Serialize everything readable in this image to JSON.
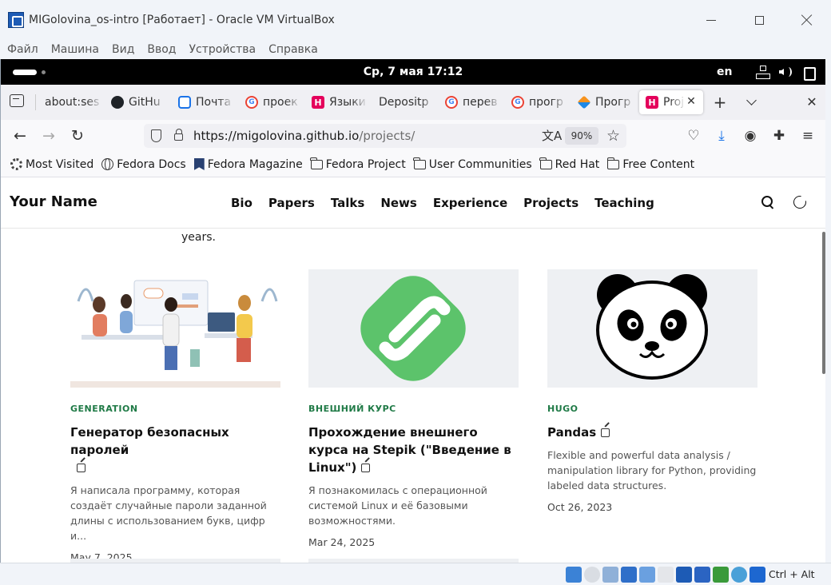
{
  "vbox": {
    "title": "MIGolovina_os-intro [Работает] - Oracle VM VirtualBox",
    "menu": [
      "Файл",
      "Машина",
      "Вид",
      "Ввод",
      "Устройства",
      "Справка"
    ],
    "host_key": "Ctrl + Alt"
  },
  "gnome": {
    "clock": "Ср, 7 мая  17:12",
    "lang": "en"
  },
  "firefox": {
    "tabs": [
      {
        "label": "about:ses",
        "favicon": "none"
      },
      {
        "label": "GitHu",
        "favicon": "github-icon"
      },
      {
        "label": "Почта",
        "favicon": "mail-icon"
      },
      {
        "label": "проек",
        "favicon": "google-icon"
      },
      {
        "label": "Языки",
        "favicon": "h-icon"
      },
      {
        "label": "Depositp",
        "favicon": "none"
      },
      {
        "label": "перев",
        "favicon": "google-icon"
      },
      {
        "label": "прогр",
        "favicon": "google-icon"
      },
      {
        "label": "Прогр",
        "favicon": "kotlin-icon"
      }
    ],
    "active_tab": {
      "label": "Proj",
      "favicon": "h-icon"
    },
    "url": {
      "host": "https://migolovina.github.io",
      "path": "/projects/",
      "zoom": "90%"
    },
    "bookmarks": [
      {
        "label": "Most Visited",
        "icon": "gear-icon"
      },
      {
        "label": "Fedora Docs",
        "icon": "globe-icon"
      },
      {
        "label": "Fedora Magazine",
        "icon": "fedora-magazine-icon"
      },
      {
        "label": "Fedora Project",
        "icon": "folder-icon"
      },
      {
        "label": "User Communities",
        "icon": "folder-icon"
      },
      {
        "label": "Red Hat",
        "icon": "folder-icon"
      },
      {
        "label": "Free Content",
        "icon": "folder-icon"
      }
    ]
  },
  "site": {
    "name": "Your Name",
    "nav": [
      "Bio",
      "Papers",
      "Talks",
      "News",
      "Experience",
      "Projects",
      "Teaching"
    ],
    "intro_tail": "years.",
    "cards": [
      {
        "tag": "GENERATION",
        "title": "Генератор безопасных паролей",
        "desc": "Я написала программу, которая создаёт случайные пароли заданной длины с использованием букв, цифр и...",
        "date": "May 7, 2025",
        "image": "team-illustration"
      },
      {
        "tag": "ВНЕШНИЙ КУРС",
        "title": "Прохождение внешнего курса на Stepik (\"Введение в Linux\")",
        "desc": "Я познакомилась с операционной системой Linux и её базовыми возможностями.",
        "date": "Mar 24, 2025",
        "image": "stepik-logo"
      },
      {
        "tag": "HUGO",
        "title": "Pandas",
        "desc": "Flexible and powerful data analysis / manipulation library for Python, providing labeled data structures.",
        "date": "Oct 26, 2023",
        "image": "panda-logo"
      }
    ]
  },
  "colors": {
    "accent_green": "#1f7a46",
    "stepik_green": "#5cc36b",
    "tab_strip": "#f0f0f4"
  }
}
